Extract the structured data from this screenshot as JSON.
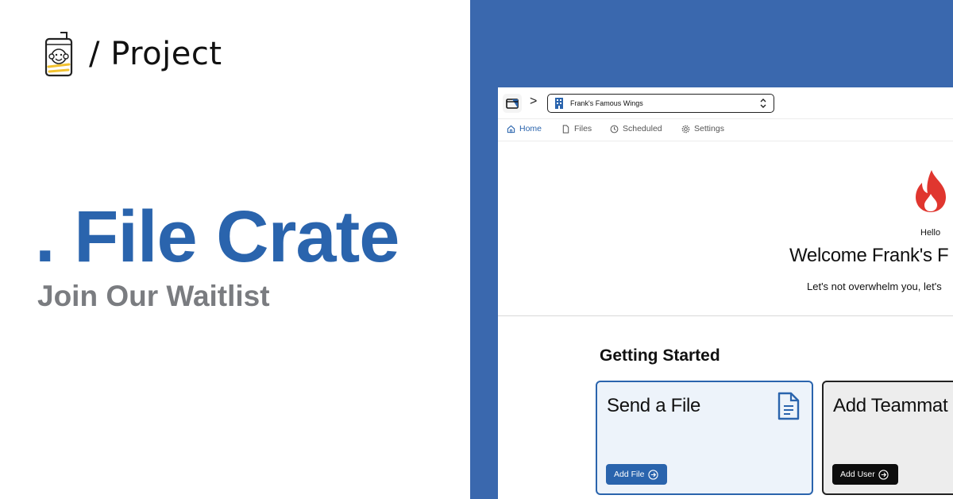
{
  "brand": {
    "separator_text": "/ Project"
  },
  "hero": {
    "title": ". File Crate",
    "subtitle": "Join Our Waitlist"
  },
  "app": {
    "crumb_separator": ">",
    "org_name": "Frank's Famous Wings",
    "tabs": [
      {
        "label": "Home",
        "icon": "home-icon",
        "active": true
      },
      {
        "label": "Files",
        "icon": "file-icon",
        "active": false
      },
      {
        "label": "Scheduled",
        "icon": "clock-icon",
        "active": false
      },
      {
        "label": "Settings",
        "icon": "gear-icon",
        "active": false
      }
    ],
    "greeting": "Hello",
    "welcome": "Welcome Frank's F",
    "tagline": "Let's not overwhelm you, let's",
    "getting_started": "Getting Started",
    "cards": [
      {
        "title": "Send a File",
        "button": "Add File",
        "icon": "document-icon"
      },
      {
        "title": "Add Teammat",
        "button": "Add User"
      }
    ]
  },
  "colors": {
    "accent_blue": "#2a64ad",
    "panel_blue": "#3a68ae",
    "subtitle_gray": "#7a7c80",
    "flame_red": "#e0362f"
  }
}
